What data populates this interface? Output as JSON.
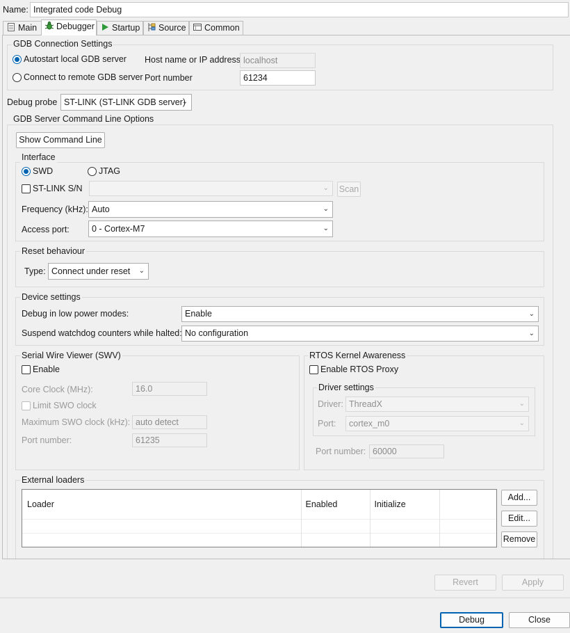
{
  "name": {
    "label": "Name:",
    "value": "Integrated code Debug"
  },
  "tabs": [
    {
      "label": "Main",
      "icon": "main-page-icon",
      "active": false
    },
    {
      "label": "Debugger",
      "icon": "debugger-bug-icon",
      "active": true
    },
    {
      "label": "Startup",
      "icon": "startup-play-icon",
      "active": false
    },
    {
      "label": "Source",
      "icon": "source-lookup-icon",
      "active": false
    },
    {
      "label": "Common",
      "icon": "common-icon",
      "active": false
    }
  ],
  "gdb_connection": {
    "title": "GDB Connection Settings",
    "autostart_label": "Autostart local GDB server",
    "autostart_selected": true,
    "remote_label": "Connect to remote GDB server",
    "remote_selected": false,
    "host_label": "Host name or IP address",
    "host_value": "localhost",
    "port_label": "Port number",
    "port_value": "61234"
  },
  "debug_probe": {
    "label": "Debug probe",
    "value": "ST-LINK (ST-LINK GDB server)"
  },
  "server_options": {
    "title": "GDB Server Command Line Options",
    "show_cmd_button": "Show Command Line"
  },
  "interface": {
    "title": "Interface",
    "swd_label": "SWD",
    "swd_selected": true,
    "jtag_label": "JTAG",
    "jtag_selected": false,
    "stlink_sn_label": "ST-LINK S/N",
    "stlink_sn_checked": false,
    "stlink_sn_value": "",
    "scan_button": "Scan",
    "frequency_label": "Frequency (kHz):",
    "frequency_value": "Auto",
    "access_port_label": "Access port:",
    "access_port_value": "0 - Cortex-M7"
  },
  "reset": {
    "title": "Reset behaviour",
    "type_label": "Type:",
    "type_value": "Connect under reset"
  },
  "device": {
    "title": "Device settings",
    "low_power_label": "Debug in low power modes:",
    "low_power_value": "Enable",
    "watchdog_label": "Suspend watchdog counters while halted:",
    "watchdog_value": "No configuration"
  },
  "swv": {
    "title": "Serial Wire Viewer (SWV)",
    "enable_label": "Enable",
    "enabled": false,
    "core_clock_label": "Core Clock (MHz):",
    "core_clock_value": "16.0",
    "limit_swo_label": "Limit SWO clock",
    "max_swo_label": "Maximum SWO clock (kHz):",
    "max_swo_value": "auto detect",
    "port_label": "Port number:",
    "port_value": "61235"
  },
  "rtos": {
    "title": "RTOS Kernel Awareness",
    "enable_label": "Enable RTOS Proxy",
    "enabled": false,
    "driver_settings_title": "Driver settings",
    "driver_label": "Driver:",
    "driver_value": "ThreadX",
    "port_label": "Port:",
    "port_value": "cortex_m0",
    "port_number_label": "Port number:",
    "port_number_value": "60000"
  },
  "external_loaders": {
    "title": "External loaders",
    "columns": [
      "Loader",
      "Enabled",
      "Initialize",
      ""
    ],
    "rows": [
      [
        "",
        "",
        "",
        ""
      ],
      [
        "",
        "",
        "",
        ""
      ]
    ],
    "add_button": "Add...",
    "edit_button": "Edit...",
    "remove_button": "Remove"
  },
  "footer": {
    "revert_button": "Revert",
    "apply_button": "Apply",
    "debug_button": "Debug",
    "close_button": "Close"
  },
  "colors": {
    "accent": "#0063b1",
    "panel_bg": "#f0f0f0",
    "field_border": "#adadad"
  }
}
